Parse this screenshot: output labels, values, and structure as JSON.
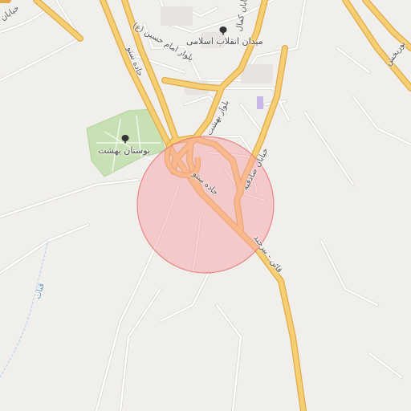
{
  "map": {
    "colors": {
      "background": "#f1efec",
      "park": "#c8e1b4",
      "major_road": "#f6cf72",
      "major_road_casing": "#e0a94a",
      "minor_road": "#ffffff",
      "minor_road_casing": "#d9d6d1",
      "highlight_fill": "#f7a3a8",
      "highlight_stroke": "#e57373",
      "water_label": "#5b8fbf"
    },
    "labels": {
      "square": "میدان انقلاب اسلامی",
      "park": "بوستان بهشت",
      "boulevard_imam": "بلوار امام حسین (ع)",
      "boulevard_behesht": "بلوار بهشت",
      "road_setu_upper": "جاده ستو",
      "road_setu_lower": "جاده ستو",
      "street_sadeghieh": "خیابان صادقیه",
      "road_ghaen_birjand": "قائن - بیرجند",
      "street_kamal": "خیابان کمال",
      "road_top_right": "بوریخش",
      "water": "قنات",
      "top_left_partial": "خیابان"
    },
    "icons": {
      "square_icon": "tree-icon",
      "park_icon": "tree-icon"
    }
  }
}
